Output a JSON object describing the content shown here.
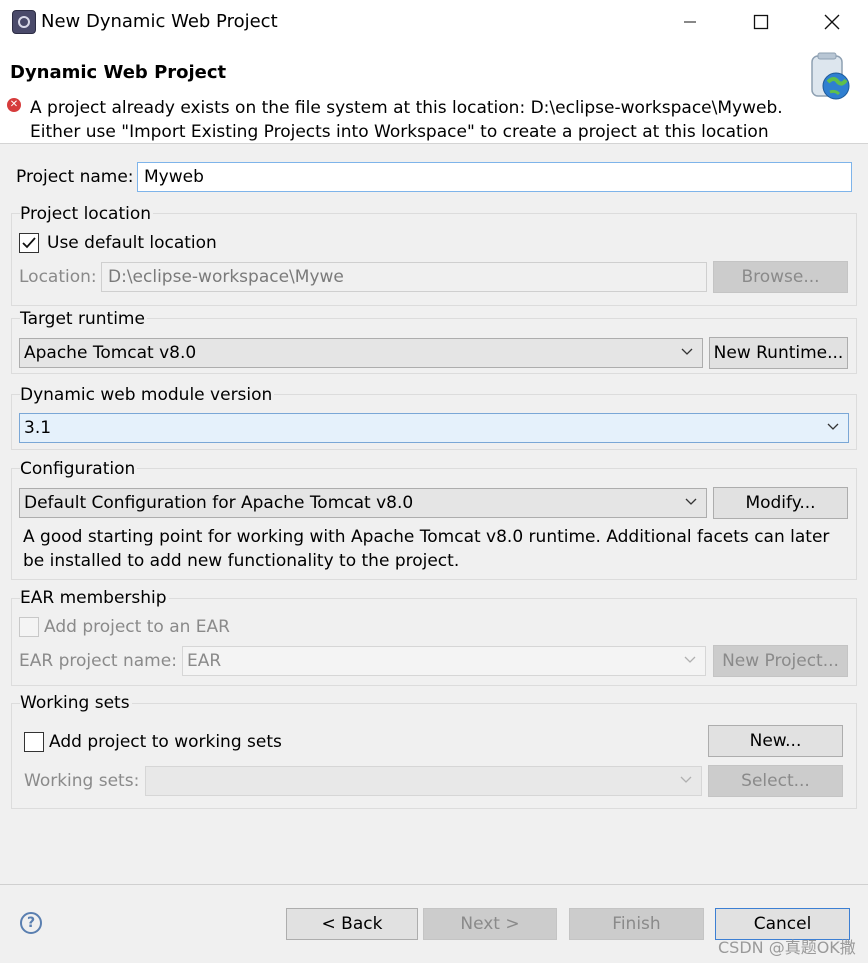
{
  "window": {
    "title": "New Dynamic Web Project"
  },
  "header": {
    "title": "Dynamic Web Project",
    "message_line1": "A project already exists on the file system at this location: D:\\eclipse-workspace\\Myweb.",
    "message_line2": "Either use \"Import Existing Projects into Workspace\" to create a project at this location"
  },
  "project_name": {
    "label": "Project name:",
    "value": "Myweb"
  },
  "project_location": {
    "group": "Project location",
    "use_default_label": "Use default location",
    "use_default_checked": true,
    "location_label": "Location:",
    "location_value": "D:\\eclipse-workspace\\Mywe",
    "browse_label": "Browse..."
  },
  "target_runtime": {
    "group": "Target runtime",
    "selected": "Apache Tomcat v8.0",
    "new_runtime_label": "New Runtime..."
  },
  "module_version": {
    "group": "Dynamic web module version",
    "selected": "3.1"
  },
  "configuration": {
    "group": "Configuration",
    "selected": "Default Configuration for Apache Tomcat v8.0",
    "modify_label": "Modify...",
    "description_line1": "A good starting point for working with Apache Tomcat v8.0 runtime. Additional facets can later",
    "description_line2": "be installed to add new functionality to the project."
  },
  "ear": {
    "group": "EAR membership",
    "add_label": "Add project to an EAR",
    "name_label": "EAR project name:",
    "name_value": "EAR",
    "new_project_label": "New Project..."
  },
  "working_sets": {
    "group": "Working sets",
    "add_label": "Add project to working sets",
    "new_label": "New...",
    "sets_label": "Working sets:",
    "select_label": "Select..."
  },
  "footer": {
    "back_label": "< Back",
    "next_label": "Next >",
    "finish_label": "Finish",
    "cancel_label": "Cancel"
  },
  "watermark": "CSDN @真题OK撒",
  "colors": {
    "error": "#d63c3c",
    "focus": "#7eb4ea",
    "default_button": "#3c7fd3"
  }
}
